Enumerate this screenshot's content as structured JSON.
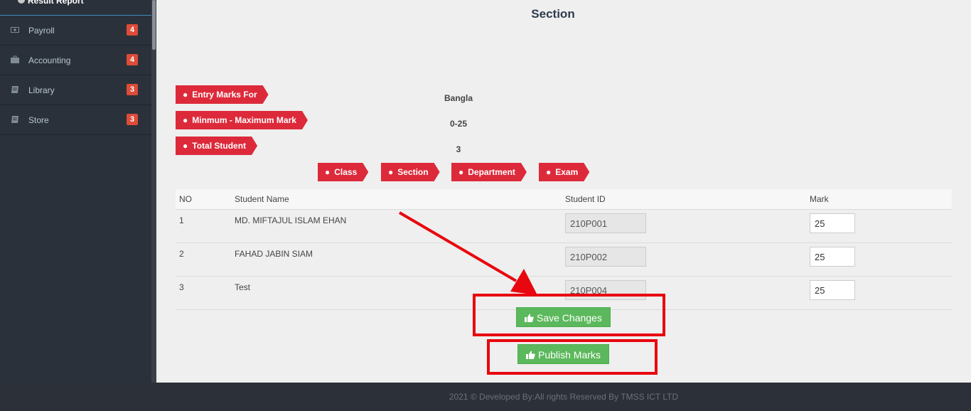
{
  "sidebar": {
    "submenu_item": "Result Report",
    "items": [
      {
        "label": "Payroll",
        "badge": "4",
        "icon": "money-icon"
      },
      {
        "label": "Accounting",
        "badge": "4",
        "icon": "briefcase-icon"
      },
      {
        "label": "Library",
        "badge": "3",
        "icon": "book-icon"
      },
      {
        "label": "Store",
        "badge": "3",
        "icon": "book-icon"
      }
    ]
  },
  "main": {
    "title": "Section",
    "info": [
      {
        "label": "Entry Marks For",
        "value": "Bangla"
      },
      {
        "label": "Minmum - Maximum Mark",
        "value": "0-25"
      },
      {
        "label": "Total Student",
        "value": "3"
      }
    ],
    "filters": [
      "Class",
      "Section",
      "Department",
      "Exam"
    ],
    "table": {
      "headers": [
        "NO",
        "Student Name",
        "Student ID",
        "Mark"
      ],
      "rows": [
        {
          "no": "1",
          "name": "MD. MIFTAJUL ISLAM EHAN",
          "student_id": "210P001",
          "mark": "25"
        },
        {
          "no": "2",
          "name": "FAHAD JABIN SIAM",
          "student_id": "210P002",
          "mark": "25"
        },
        {
          "no": "3",
          "name": "Test",
          "student_id": "210P004",
          "mark": "25"
        }
      ]
    },
    "save_label": "Save Changes",
    "publish_label": "Publish Marks"
  },
  "footer": {
    "text": "2021 © Developed By:All rights Reserved By TMSS ICT LTD"
  },
  "colors": {
    "tag_red": "#dd2a3a",
    "button_green": "#5cb85c",
    "annotation_red": "#e8070e",
    "sidebar_bg": "#2b313a"
  }
}
